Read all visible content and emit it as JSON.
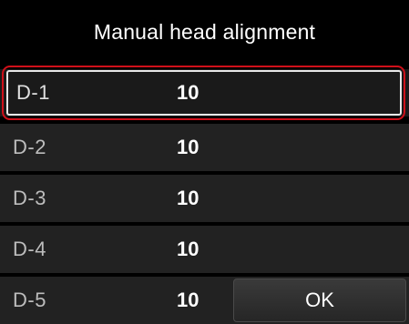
{
  "screen": {
    "title": "Manual head alignment"
  },
  "rows": [
    {
      "label": "D-1",
      "value": "10",
      "selected": true
    },
    {
      "label": "D-2",
      "value": "10",
      "selected": false
    },
    {
      "label": "D-3",
      "value": "10",
      "selected": false
    },
    {
      "label": "D-4",
      "value": "10",
      "selected": false
    },
    {
      "label": "D-5",
      "value": "10",
      "selected": false
    }
  ],
  "ok_button": {
    "label": "OK"
  },
  "colors": {
    "background": "#000000",
    "row_background": "#222222",
    "selection_outline": "#d0101a",
    "selection_inner": "#e8e8e8"
  }
}
